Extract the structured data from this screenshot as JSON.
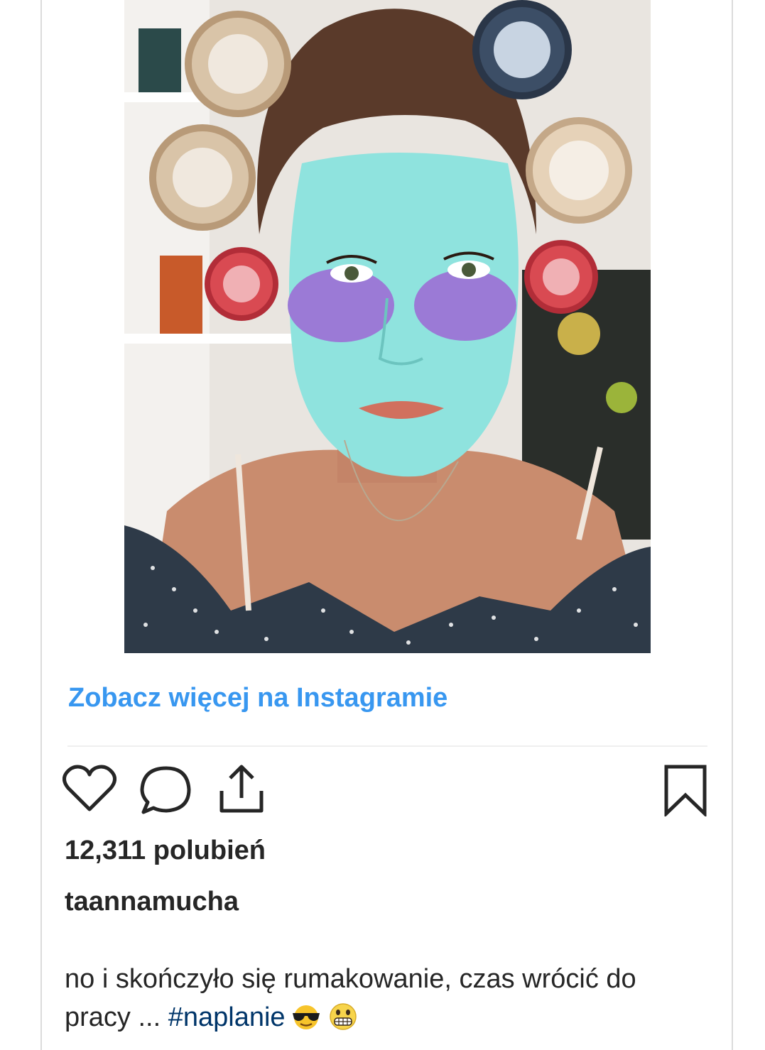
{
  "post": {
    "image": {
      "alt": "",
      "colors": {
        "mask": "#8fe3de",
        "eye_patch": "#9b7ad6",
        "hair": "#5a3a2a",
        "skin": "#c98c6e",
        "curler_red": "#d94a52",
        "background": "#e8e4df",
        "top": "#2e3a48"
      }
    },
    "view_more_link": "Zobacz więcej na Instagramie",
    "actions": {
      "like_icon": "heart-outline-icon",
      "comment_icon": "speech-bubble-icon",
      "share_icon": "share-upload-icon",
      "save_icon": "bookmark-icon"
    },
    "likes": "12,311 polubień",
    "username": "taannamucha",
    "caption": {
      "text": "no i skończyło się rumakowanie, czas wrócić do pracy ... ",
      "hashtag": "#naplanie",
      "emojis": [
        "smiling-face-with-sunglasses",
        "grimacing-face"
      ]
    }
  },
  "theme": {
    "link_color": "#3897f0",
    "text_color": "#262626",
    "hashtag_color": "#003569",
    "border_color": "#dbdbdb"
  }
}
